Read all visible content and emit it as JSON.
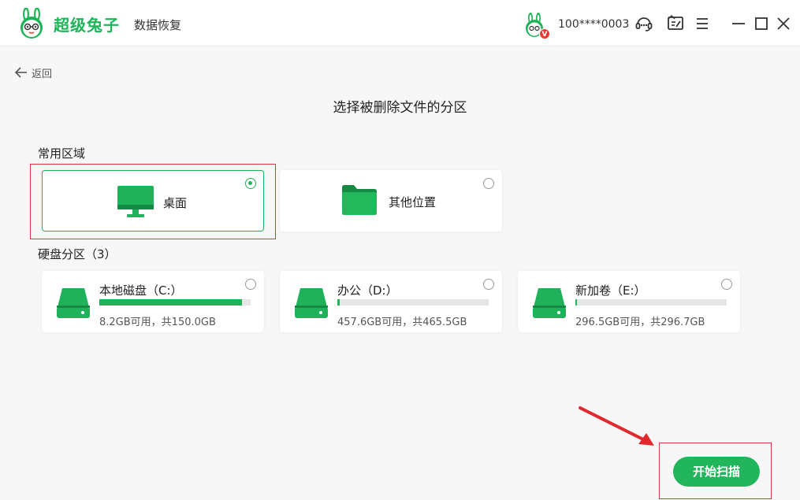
{
  "app": {
    "brand": "超级兔子",
    "product": "数据恢复",
    "user_id": "100****0003",
    "vip_badge": "V"
  },
  "nav": {
    "back_label": "返回"
  },
  "page_title": "选择被删除文件的分区",
  "common_area": {
    "label": "常用区域",
    "items": [
      {
        "label": "桌面",
        "icon": "monitor-icon",
        "selected": true
      },
      {
        "label": "其他位置",
        "icon": "folder-icon",
        "selected": false
      }
    ]
  },
  "disk_partitions": {
    "label": "硬盘分区（3）",
    "items": [
      {
        "name": "本地磁盘（C:）",
        "capacity_text": "8.2GB可用，共150.0GB",
        "used_fraction": 0.945,
        "selected": false
      },
      {
        "name": "办公（D:）",
        "capacity_text": "457.6GB可用，共465.5GB",
        "used_fraction": 0.017,
        "selected": false
      },
      {
        "name": "新加卷（E:）",
        "capacity_text": "296.5GB可用，共296.7GB",
        "used_fraction": 0.007,
        "selected": false
      }
    ]
  },
  "actions": {
    "start_scan_label": "开始扫描"
  },
  "colors": {
    "accent": "#20b25a",
    "highlight": "#d9383f",
    "badge": "#e8392d"
  }
}
